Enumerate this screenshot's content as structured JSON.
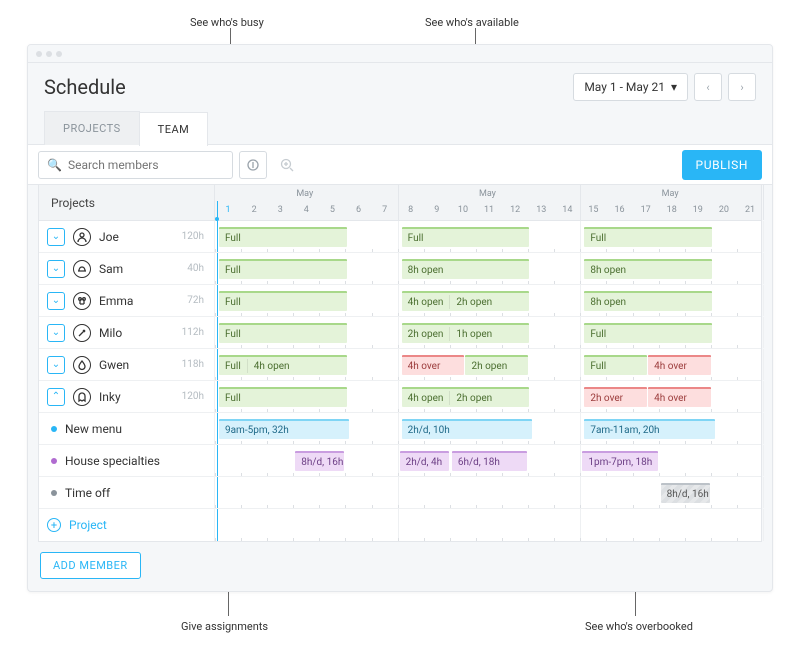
{
  "callouts": {
    "busy": "See who's busy",
    "available": "See who's available",
    "assignments": "Give assignments",
    "overbooked": "See who's overbooked"
  },
  "header": {
    "title": "Schedule",
    "date_range": "May 1 - May 21"
  },
  "tabs": {
    "projects": "PROJECTS",
    "team": "TEAM"
  },
  "toolbar": {
    "search_placeholder": "Search members",
    "publish": "PUBLISH"
  },
  "grid": {
    "projects_label": "Projects",
    "month_label": "May",
    "days": [
      1,
      2,
      3,
      4,
      5,
      6,
      7,
      8,
      9,
      10,
      11,
      12,
      13,
      14,
      15,
      16,
      17,
      18,
      19,
      20,
      21
    ],
    "weeks": [
      {
        "start": 1,
        "end": 7
      },
      {
        "start": 8,
        "end": 14
      },
      {
        "start": 15,
        "end": 21
      }
    ],
    "today": 1
  },
  "members": [
    {
      "name": "Joe",
      "hours": "120h",
      "open": true,
      "icon": "person",
      "bars": [
        {
          "week": 0,
          "type": "green",
          "segs": [
            "Full"
          ]
        },
        {
          "week": 1,
          "type": "green",
          "segs": [
            "Full"
          ]
        },
        {
          "week": 2,
          "type": "green",
          "segs": [
            "Full"
          ]
        }
      ]
    },
    {
      "name": "Sam",
      "hours": "40h",
      "open": true,
      "icon": "hat",
      "bars": [
        {
          "week": 0,
          "type": "green",
          "segs": [
            "Full"
          ]
        },
        {
          "week": 1,
          "type": "green",
          "segs": [
            "8h open"
          ]
        },
        {
          "week": 2,
          "type": "green",
          "segs": [
            "8h open"
          ]
        }
      ]
    },
    {
      "name": "Emma",
      "hours": "72h",
      "open": true,
      "icon": "chef",
      "bars": [
        {
          "week": 0,
          "type": "green",
          "segs": [
            "Full"
          ]
        },
        {
          "week": 1,
          "type": "green",
          "segs": [
            "4h open",
            "2h open"
          ]
        },
        {
          "week": 2,
          "type": "green",
          "segs": [
            "8h open"
          ]
        }
      ]
    },
    {
      "name": "Milo",
      "hours": "112h",
      "open": true,
      "icon": "knife",
      "bars": [
        {
          "week": 0,
          "type": "green",
          "segs": [
            "Full"
          ]
        },
        {
          "week": 1,
          "type": "green",
          "segs": [
            "2h open",
            "1h open"
          ]
        },
        {
          "week": 2,
          "type": "green",
          "segs": [
            "Full"
          ]
        }
      ]
    },
    {
      "name": "Gwen",
      "hours": "118h",
      "open": true,
      "icon": "drop",
      "bars": [
        {
          "week": 0,
          "type": "green",
          "segs": [
            "Full",
            "4h open"
          ]
        },
        {
          "week": 1,
          "type": "mix",
          "segs": [
            {
              "t": "4h over",
              "c": "red"
            },
            {
              "t": "2h open",
              "c": "green"
            }
          ]
        },
        {
          "week": 2,
          "type": "mix",
          "segs": [
            {
              "t": "Full",
              "c": "green"
            },
            {
              "t": "4h over",
              "c": "red"
            }
          ]
        }
      ]
    },
    {
      "name": "Inky",
      "hours": "120h",
      "open": false,
      "icon": "ghost",
      "bars": [
        {
          "week": 0,
          "type": "green",
          "segs": [
            "Full"
          ]
        },
        {
          "week": 1,
          "type": "green",
          "segs": [
            "4h open",
            "2h open"
          ]
        },
        {
          "week": 2,
          "type": "mix",
          "segs": [
            {
              "t": "2h over",
              "c": "red"
            },
            {
              "t": "4h over",
              "c": "red"
            }
          ]
        }
      ]
    }
  ],
  "tasks": [
    {
      "name": "New menu",
      "dot": "#29b6f6",
      "bars": [
        {
          "week": 0,
          "type": "blue",
          "label": "9am-5pm, 32h"
        },
        {
          "week": 1,
          "type": "blue",
          "label": "2h/d, 10h"
        },
        {
          "week": 2,
          "type": "blue",
          "label": "7am-11am, 20h"
        }
      ]
    },
    {
      "name": "House specialties",
      "dot": "#b06bd0",
      "bars": [
        {
          "week": 0,
          "type": "purple",
          "label": "8h/d, 16h",
          "start": 4,
          "end": 5
        },
        {
          "week": 1,
          "type": "purple",
          "label": "2h/d, 4h",
          "start": 8,
          "end": 9
        },
        {
          "week": 1,
          "type": "purple",
          "label": "6h/d, 18h",
          "start": 10,
          "end": 12
        },
        {
          "week": 2,
          "type": "purple",
          "label": "1pm-7pm, 18h",
          "start": 15,
          "end": 17
        }
      ]
    },
    {
      "name": "Time off",
      "dot": "#8a939b",
      "bars": [
        {
          "week": 2,
          "type": "gray",
          "label": "8h/d, 16h",
          "start": 18,
          "end": 19
        }
      ]
    }
  ],
  "add_project_label": "Project",
  "add_member_label": "ADD MEMBER"
}
